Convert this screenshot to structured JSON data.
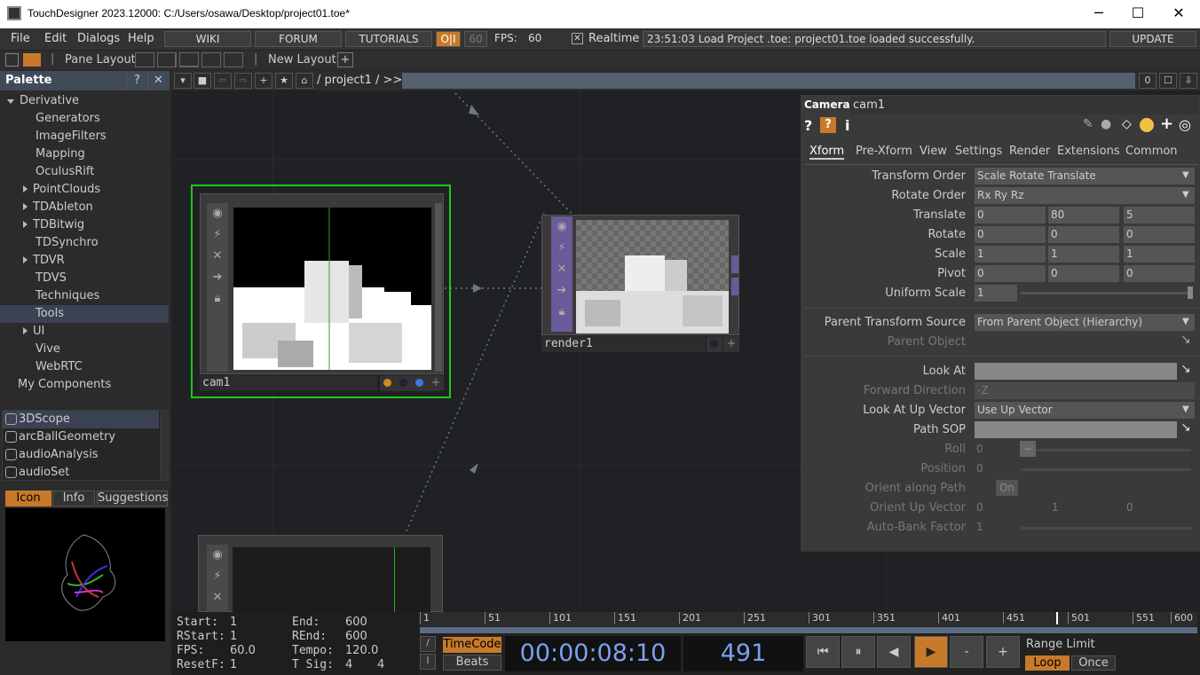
{
  "window": {
    "title": "TouchDesigner 2023.12000: C:/Users/osawa/Desktop/project01.toe*",
    "minimize": "─",
    "maximize": "☐",
    "close": "✕"
  },
  "menu": {
    "file": "File",
    "edit": "Edit",
    "dialogs": "Dialogs",
    "help": "Help",
    "wiki": "WIKI",
    "forum": "FORUM",
    "tutorials": "TUTORIALS",
    "oi": "O|I",
    "fps_cap": "60",
    "fps_label": "FPS:",
    "fps_value": "60",
    "realtime_check": "✕",
    "realtime": "Realtime",
    "status": "23:51:03 Load Project .toe: project01.toe loaded successfully.",
    "update": "UPDATE"
  },
  "layoutbar": {
    "pane_layout": "Pane Layout",
    "new_layout": "New Layout",
    "add": "+"
  },
  "palette": {
    "title": "Palette",
    "help": "?",
    "close": "✕",
    "tree": [
      {
        "label": "Derivative",
        "indent": 0,
        "arrow": "down",
        "selected": false
      },
      {
        "label": "Generators",
        "indent": 2,
        "arrow": "",
        "selected": false
      },
      {
        "label": "ImageFilters",
        "indent": 2,
        "arrow": "",
        "selected": false
      },
      {
        "label": "Mapping",
        "indent": 2,
        "arrow": "",
        "selected": false
      },
      {
        "label": "OculusRift",
        "indent": 2,
        "arrow": "",
        "selected": false
      },
      {
        "label": "PointClouds",
        "indent": 1,
        "arrow": "right",
        "selected": false
      },
      {
        "label": "TDAbleton",
        "indent": 1,
        "arrow": "right",
        "selected": false
      },
      {
        "label": "TDBitwig",
        "indent": 1,
        "arrow": "right",
        "selected": false
      },
      {
        "label": "TDSynchro",
        "indent": 2,
        "arrow": "",
        "selected": false
      },
      {
        "label": "TDVR",
        "indent": 1,
        "arrow": "right",
        "selected": false
      },
      {
        "label": "TDVS",
        "indent": 2,
        "arrow": "",
        "selected": false
      },
      {
        "label": "Techniques",
        "indent": 2,
        "arrow": "",
        "selected": false
      },
      {
        "label": "Tools",
        "indent": 2,
        "arrow": "",
        "selected": true
      },
      {
        "label": "UI",
        "indent": 1,
        "arrow": "right",
        "selected": false
      },
      {
        "label": "Vive",
        "indent": 2,
        "arrow": "",
        "selected": false
      },
      {
        "label": "WebRTC",
        "indent": 2,
        "arrow": "",
        "selected": false
      },
      {
        "label": "My Components",
        "indent": 0.5,
        "arrow": "",
        "selected": false
      }
    ],
    "components": [
      "3DScope",
      "arcBallGeometry",
      "audioAnalysis",
      "audioSet"
    ],
    "tabs": {
      "icon": "Icon",
      "info": "Info",
      "suggestions": "Suggestions"
    }
  },
  "network": {
    "path": "/ project1 / >>",
    "pane_count": "0",
    "nodes": {
      "cam1": "cam1",
      "render1": "render1"
    }
  },
  "params": {
    "op_type": "Camera",
    "op_name": "cam1",
    "tabs": [
      "Xform",
      "Pre-Xform",
      "View",
      "Settings",
      "Render",
      "Extensions",
      "Common"
    ],
    "rows": {
      "transform_order": {
        "label": "Transform Order",
        "value": "Scale Rotate Translate"
      },
      "rotate_order": {
        "label": "Rotate Order",
        "value": "Rx Ry Rz"
      },
      "translate": {
        "label": "Translate",
        "x": "0",
        "y": "80",
        "z": "5"
      },
      "rotate": {
        "label": "Rotate",
        "x": "0",
        "y": "0",
        "z": "0"
      },
      "scale": {
        "label": "Scale",
        "x": "1",
        "y": "1",
        "z": "1"
      },
      "pivot": {
        "label": "Pivot",
        "x": "0",
        "y": "0",
        "z": "0"
      },
      "uniform_scale": {
        "label": "Uniform Scale",
        "value": "1"
      },
      "parent_transform_source": {
        "label": "Parent Transform Source",
        "value": "From Parent Object (Hierarchy)"
      },
      "parent_object": {
        "label": "Parent Object"
      },
      "look_at": {
        "label": "Look At"
      },
      "forward_direction": {
        "label": "Forward Direction",
        "value": "-Z"
      },
      "look_at_up_vector": {
        "label": "Look At Up Vector",
        "value": "Use Up Vector"
      },
      "path_sop": {
        "label": "Path SOP"
      },
      "roll": {
        "label": "Roll",
        "value": "0",
        "slider": "−"
      },
      "position": {
        "label": "Position",
        "value": "0"
      },
      "orient_along_path": {
        "label": "Orient along Path",
        "value": "On"
      },
      "orient_up_vector": {
        "label": "Orient Up Vector",
        "x": "0",
        "y": "1",
        "z": "0"
      },
      "auto_bank_factor": {
        "label": "Auto-Bank Factor",
        "value": "1"
      }
    }
  },
  "timeline": {
    "start_label": "Start:",
    "start": "1",
    "end_label": "End:",
    "end": "600",
    "rstart_label": "RStart:",
    "rstart": "1",
    "rend_label": "REnd:",
    "rend": "600",
    "fps_label": "FPS:",
    "fps": "60.0",
    "tempo_label": "Tempo:",
    "tempo": "120.0",
    "resetf_label": "ResetF:",
    "resetf": "1",
    "tsig_label": "T Sig:",
    "tsig_a": "4",
    "tsig_b": "4",
    "ruler": [
      "1",
      "51",
      "101",
      "151",
      "201",
      "251",
      "301",
      "351",
      "401",
      "451",
      "501",
      "551",
      "600"
    ],
    "timecode_btn": "TimeCode",
    "beats_btn": "Beats",
    "timecode": "00:00:08:10",
    "frame": "491",
    "range_limit": "Range Limit",
    "loop": "Loop",
    "once": "Once",
    "btn_start": "⏮",
    "btn_pause": "⏸",
    "btn_back": "◀",
    "btn_play": "▶",
    "btn_minus": "-",
    "btn_plus": "+"
  }
}
